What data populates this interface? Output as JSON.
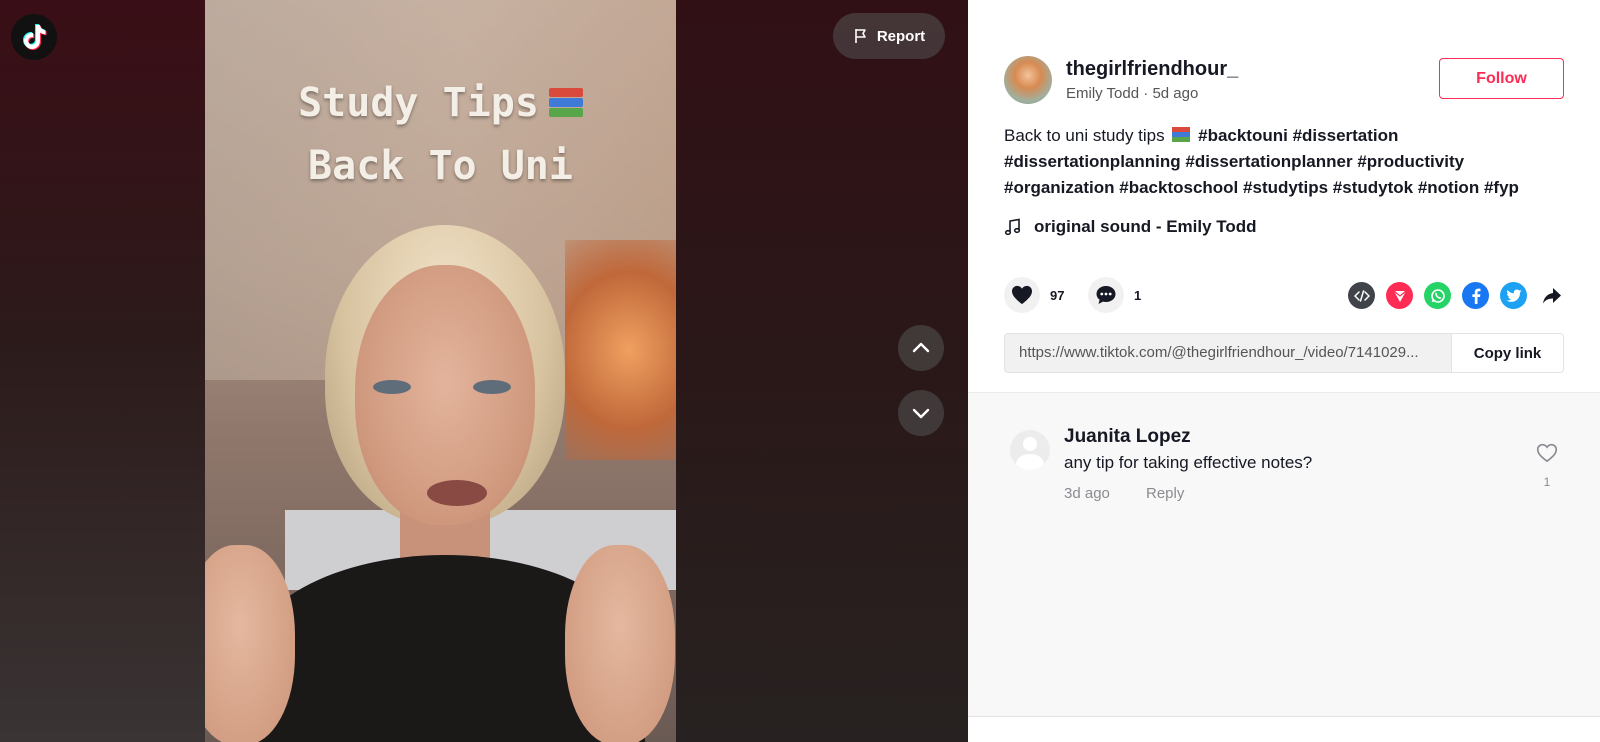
{
  "video": {
    "overlay_line1": "Study Tips",
    "overlay_line2": "Back To Uni",
    "report_label": "Report"
  },
  "author": {
    "username": "thegirlfriendhour_",
    "display_name": "Emily Todd",
    "separator": " · ",
    "posted": "5d ago",
    "follow_label": "Follow"
  },
  "caption": {
    "text": "Back to uni study tips",
    "hashtags": [
      "#backtouni",
      "#dissertation",
      "#dissertationplanning",
      "#dissertationplanner",
      "#productivity",
      "#organization",
      "#backtoschool",
      "#studytips",
      "#studytok",
      "#notion",
      "#fyp"
    ]
  },
  "music": {
    "label": "original sound - Emily Todd"
  },
  "stats": {
    "likes": "97",
    "comments": "1"
  },
  "share": {
    "icons": [
      "embed-icon",
      "send-icon",
      "whatsapp-icon",
      "facebook-icon",
      "twitter-icon",
      "share-arrow-icon"
    ],
    "colors": {
      "embed": "#41434b",
      "send": "#fe2c55",
      "whatsapp": "#25d366",
      "facebook": "#1877f2",
      "twitter": "#1da1f2"
    }
  },
  "link": {
    "url": "https://www.tiktok.com/@thegirlfriendhour_/video/7141029...",
    "copy_label": "Copy link"
  },
  "comments": [
    {
      "name": "Juanita Lopez",
      "text": "any tip for taking effective notes?",
      "time": "3d ago",
      "reply_label": "Reply",
      "likes": "1"
    }
  ],
  "colors": {
    "accent": "#fe2c55",
    "text": "#161823",
    "muted": "#8a8b91"
  }
}
